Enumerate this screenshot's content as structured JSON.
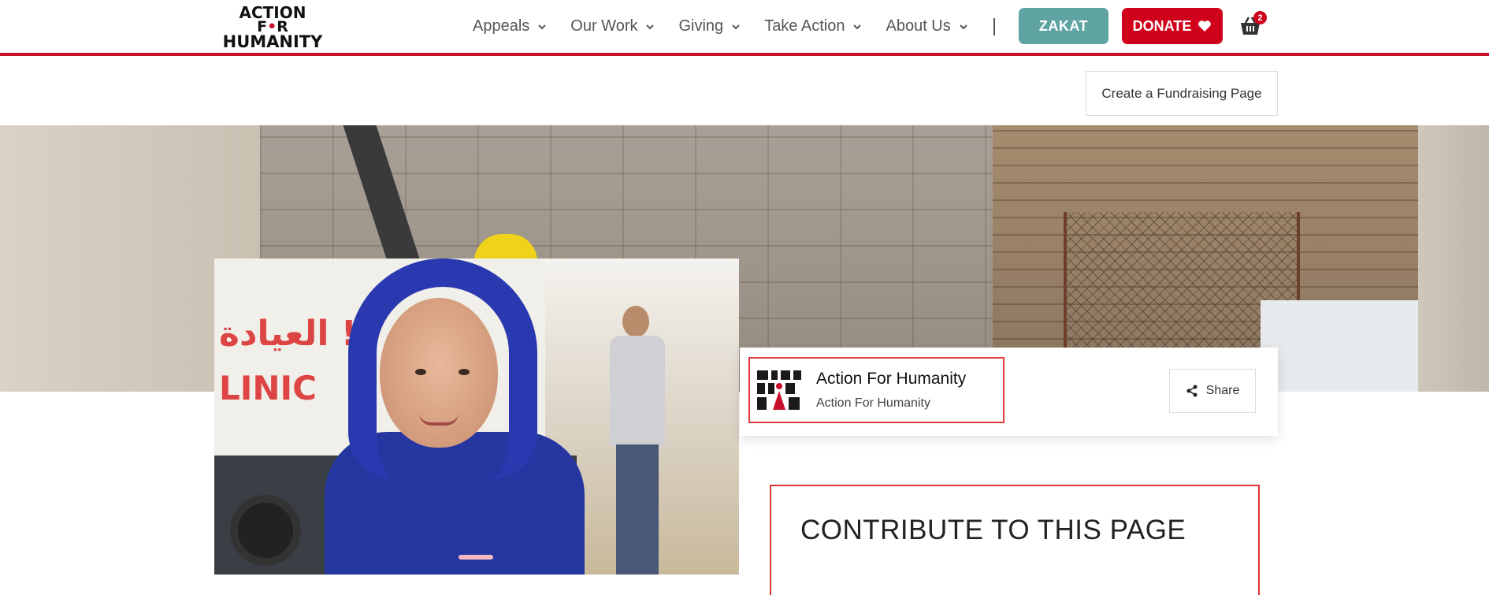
{
  "header": {
    "logo": {
      "line1": "ACTION",
      "line2_a": "F",
      "line2_b": "R",
      "line3": "HUMANITY",
      "brand_color": "#c8102e"
    },
    "nav": [
      {
        "label": "Appeals"
      },
      {
        "label": "Our Work"
      },
      {
        "label": "Giving"
      },
      {
        "label": "Take Action"
      },
      {
        "label": "About Us"
      }
    ],
    "zakat_label": "ZAKAT",
    "zakat_color": "#5fa3a3",
    "donate_label": "DONATE",
    "donate_color": "#d0021b",
    "cart_count": "2"
  },
  "secondary": {
    "fundraise_label": "Create a Fundraising Page"
  },
  "profile": {
    "name": "Action For Humanity",
    "subtitle": "Action For Humanity",
    "share_label": "Share"
  },
  "photo": {
    "clinic_text": "LINIC",
    "arabic_text": "العيادة !!"
  },
  "contribute": {
    "title": "CONTRIBUTE TO THIS PAGE"
  }
}
